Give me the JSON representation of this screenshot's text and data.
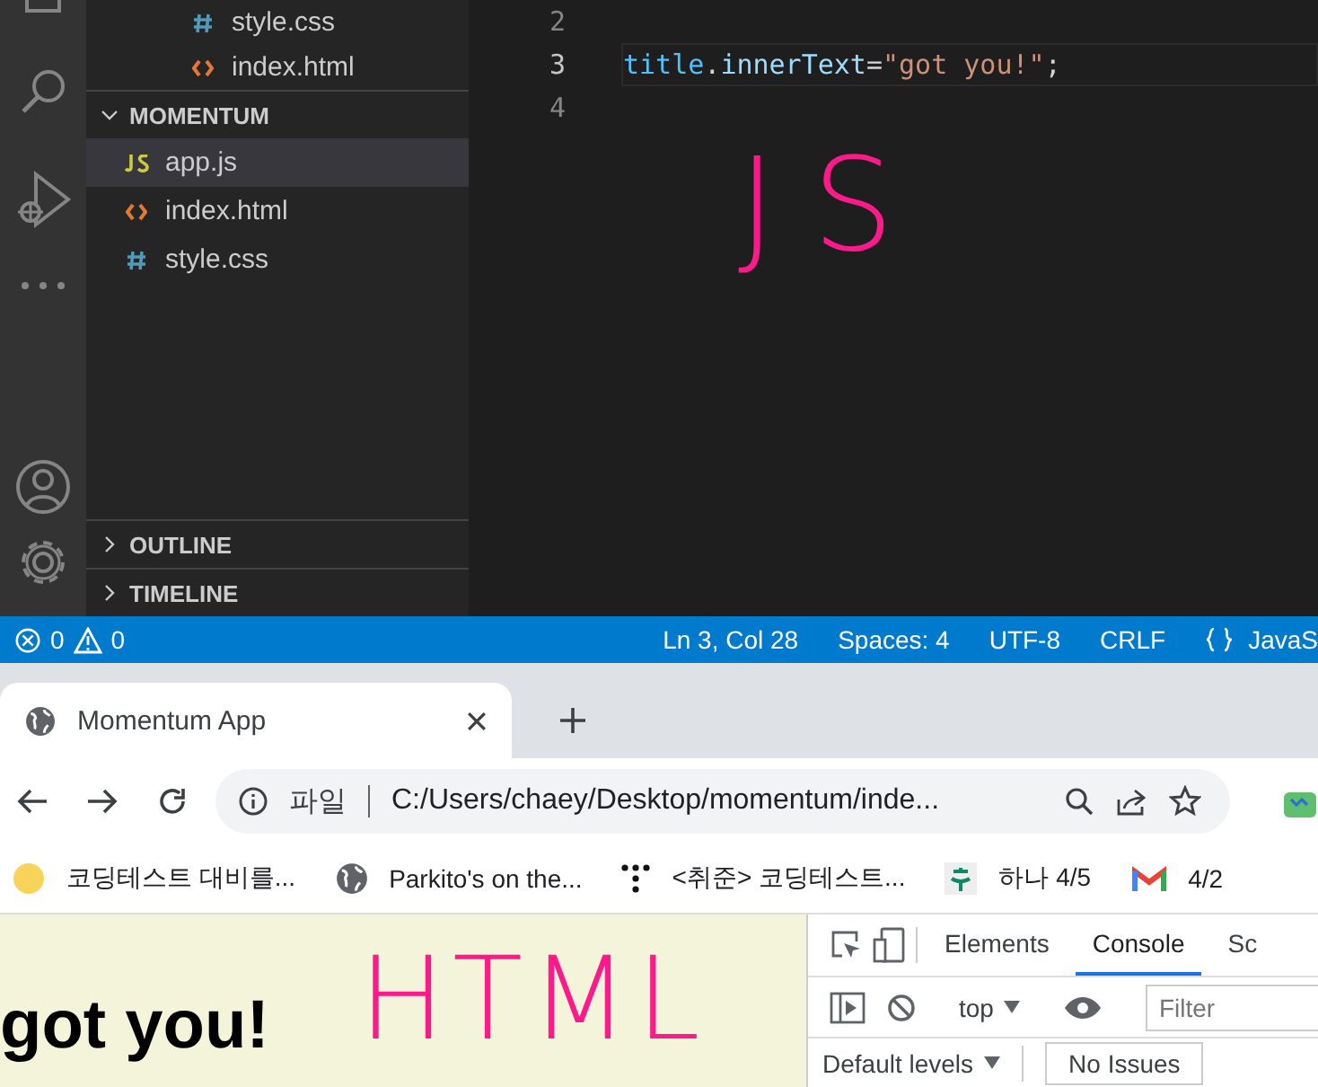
{
  "vscode": {
    "explorer": {
      "folder_items": [
        {
          "name": "style.css",
          "kind": "css"
        },
        {
          "name": "index.html",
          "kind": "html"
        }
      ],
      "section": {
        "title": "MOMENTUM",
        "expanded": true,
        "files": [
          {
            "name": "app.js",
            "kind": "js",
            "selected": true
          },
          {
            "name": "index.html",
            "kind": "html",
            "selected": false
          },
          {
            "name": "style.css",
            "kind": "css",
            "selected": false
          }
        ]
      },
      "collapsed_sections": [
        {
          "title": "OUTLINE",
          "expanded": false
        },
        {
          "title": "TIMELINE",
          "expanded": false
        }
      ]
    },
    "editor": {
      "lines": [
        {
          "number": "2",
          "current": false
        },
        {
          "number": "3",
          "current": true,
          "tokens": [
            {
              "text": "title",
              "kind": "variable"
            },
            {
              "text": ".",
              "kind": "punct"
            },
            {
              "text": "innerText",
              "kind": "property"
            },
            {
              "text": "=",
              "kind": "punct"
            },
            {
              "text": "\"got you!\"",
              "kind": "string"
            },
            {
              "text": ";",
              "kind": "punct"
            }
          ]
        },
        {
          "number": "4",
          "current": false
        }
      ],
      "annotation": "JS"
    },
    "status_bar": {
      "errors": "0",
      "warnings": "0",
      "items": [
        "Ln 3, Col 28",
        "Spaces: 4",
        "UTF-8",
        "CRLF"
      ],
      "language": "JavaS"
    }
  },
  "browser": {
    "tabs": [
      {
        "title": "Momentum App",
        "selected": true
      }
    ],
    "address": {
      "scheme_label": "파일",
      "url": "C:/Users/chaey/Desktop/momentum/inde..."
    },
    "bookmarks": [
      {
        "label": "코딩테스트 대비를...",
        "kind": "moon"
      },
      {
        "label": "Parkito's on the...",
        "kind": "globe"
      },
      {
        "label": "<취준> 코딩테스트...",
        "kind": "dots"
      },
      {
        "label": "하나 4/5",
        "kind": "logo"
      },
      {
        "label": "4/2",
        "kind": "mail"
      }
    ],
    "page": {
      "heading": "got you!",
      "annotation": "HTML"
    },
    "devtools": {
      "tabs": [
        {
          "label": "Elements",
          "selected": false
        },
        {
          "label": "Console",
          "selected": true
        },
        {
          "label": "Sc",
          "selected": false
        }
      ],
      "context": "top",
      "filter_placeholder": "Filter",
      "levels": "Default levels",
      "issues": "No Issues"
    }
  }
}
